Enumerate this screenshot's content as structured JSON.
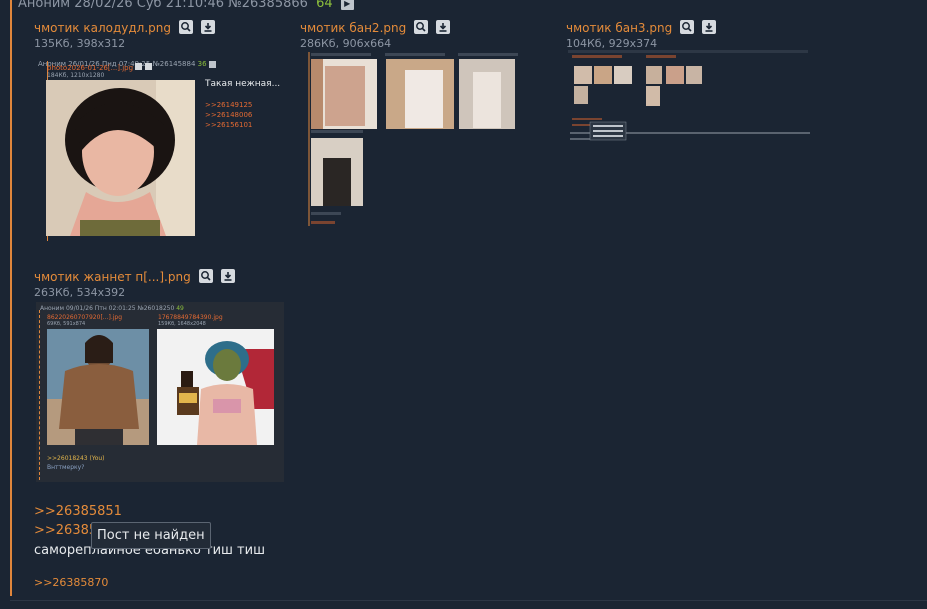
{
  "post": {
    "author": "Аноним",
    "date": "28/02/26 Суб 21:10:46",
    "number": "№26385866",
    "reply_count": "64"
  },
  "files": [
    {
      "name": "чмотик калодудл.png",
      "meta": "135Кб, 398x312"
    },
    {
      "name": "чмотик бан2.png",
      "meta": "286Кб, 906x664"
    },
    {
      "name": "чмотик бан3.png",
      "meta": "104Кб, 929x374"
    },
    {
      "name": "чмотик жаннет п[...].png",
      "meta": "263Кб, 534x392"
    }
  ],
  "thumb1": {
    "header": "Аноним 26/01/26 Пнд 07:49:25 №26145884",
    "replies": "36",
    "file_name": "photo2026-01-26[...].jpg",
    "file_meta": "184Кб, 1210x1280",
    "text": "Такая нежная...",
    "links": [
      ">>26149125",
      ">>26148006",
      ">>26156101"
    ]
  },
  "thumb4": {
    "header": "Аноним 09/01/26 Птн 02:01:25 №26018250",
    "replies": "49",
    "file1": "86220260707920[...].jpg",
    "file1_meta": "69Кб, 591x874",
    "file2": "17678849784390.jpg",
    "file2_meta": "159Кб, 1648x2048",
    "link": ">>26018243 (You)",
    "text": "Внттмерку?"
  },
  "body": {
    "link1": ">>26385851",
    "link2": ">>26385",
    "text": "самореплайное ебанько тиш тиш",
    "link3": ">>26385870"
  },
  "tooltip": "Пост не найден",
  "colors": {
    "background": "#1b2533",
    "accent": "#e48b3a",
    "reply_green": "#8cbf3c"
  }
}
